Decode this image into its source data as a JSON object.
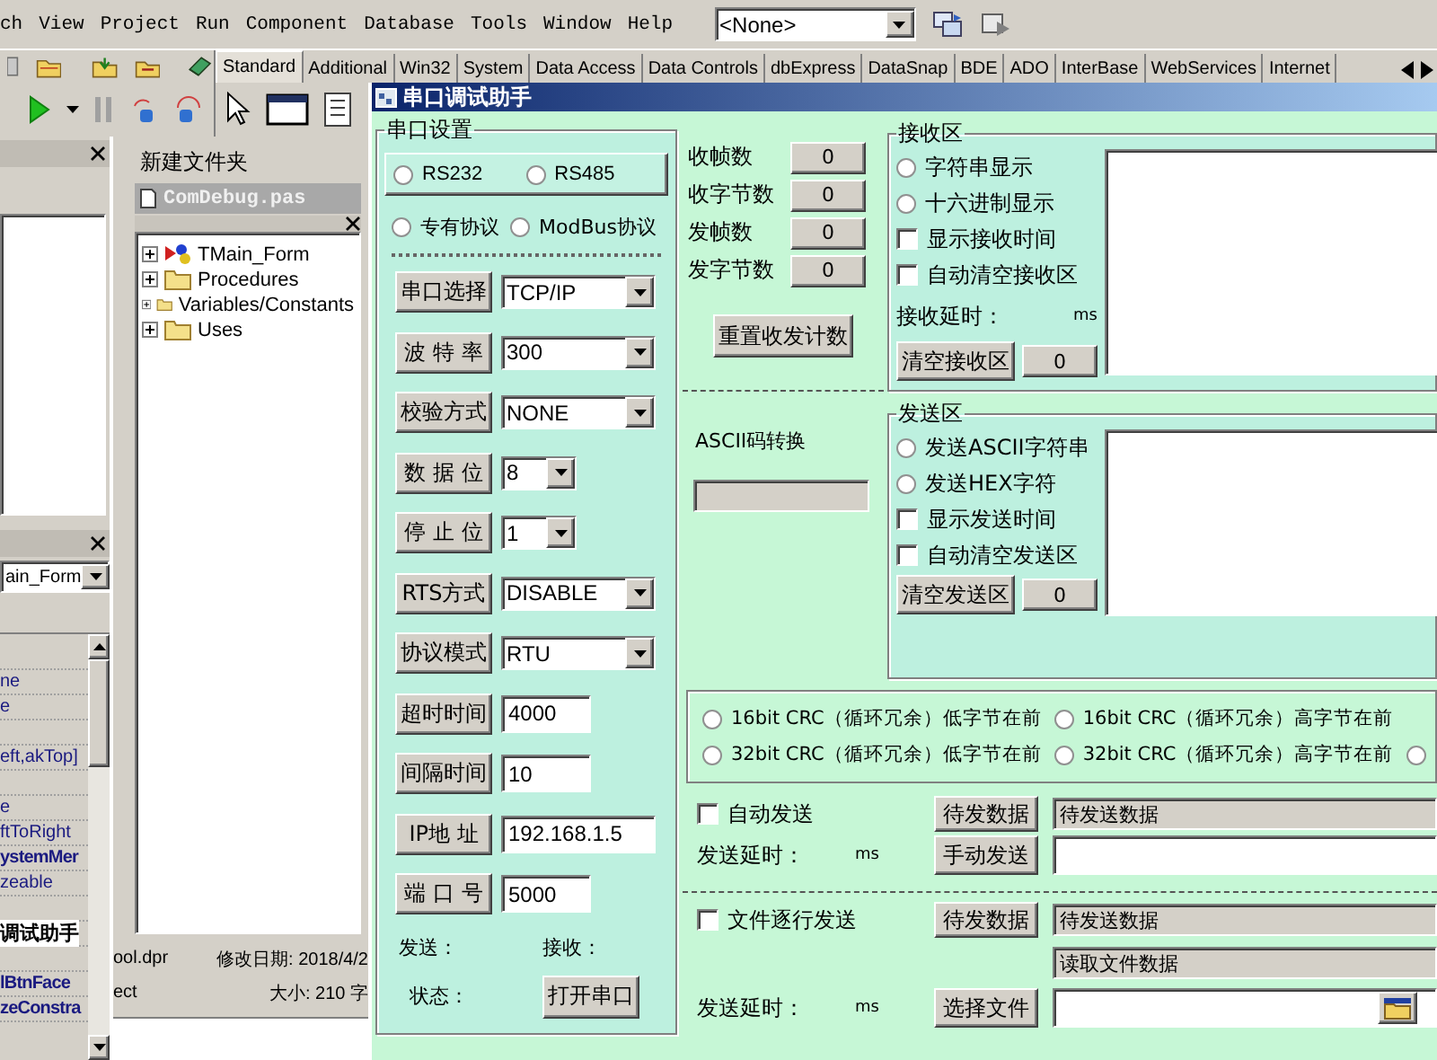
{
  "menu_bar": {
    "items": [
      "ch",
      "View",
      "Project",
      "Run",
      "Component",
      "Database",
      "Tools",
      "Window",
      "Help"
    ],
    "selector": {
      "value": "<None>"
    }
  },
  "component_palette": {
    "tabs": [
      {
        "label": "Standard",
        "selected": true
      },
      {
        "label": "Additional",
        "selected": false
      },
      {
        "label": "Win32",
        "selected": false
      },
      {
        "label": "System",
        "selected": false
      },
      {
        "label": "Data Access",
        "selected": false
      },
      {
        "label": "Data Controls",
        "selected": false
      },
      {
        "label": "dbExpress",
        "selected": false
      },
      {
        "label": "DataSnap",
        "selected": false
      },
      {
        "label": "BDE",
        "selected": false
      },
      {
        "label": "ADO",
        "selected": false
      },
      {
        "label": "InterBase",
        "selected": false
      },
      {
        "label": "WebServices",
        "selected": false
      },
      {
        "label": "Internet",
        "selected": false
      }
    ]
  },
  "inspector": {
    "selector": "ain_Form",
    "rows": [
      {
        "kind": "blank"
      },
      {
        "kind": "plain",
        "value": "ne"
      },
      {
        "kind": "plain",
        "value": "e"
      },
      {
        "kind": "blank"
      },
      {
        "kind": "plain",
        "value": "eft,akTop]"
      },
      {
        "kind": "blank"
      },
      {
        "kind": "plain",
        "value": "e"
      },
      {
        "kind": "plain",
        "value": "ftToRight"
      },
      {
        "kind": "bold",
        "value": "ystemMer"
      },
      {
        "kind": "plain",
        "value": "zeable"
      },
      {
        "kind": "blank"
      },
      {
        "kind": "editing",
        "value": "调试助手"
      },
      {
        "kind": "blank"
      },
      {
        "kind": "bold",
        "value": "lBtnFace"
      },
      {
        "kind": "bold",
        "value": "zeConstra"
      }
    ]
  },
  "explorer": {
    "title": "新建文件夹",
    "file_tab": "ComDebug.pas",
    "tree": [
      {
        "label": "TMain_Form",
        "kind": "component",
        "expanded": false
      },
      {
        "label": "Procedures",
        "kind": "folder",
        "expanded": false
      },
      {
        "label": "Variables/Constants",
        "kind": "folder",
        "expanded": false
      },
      {
        "label": "Uses",
        "kind": "folder",
        "expanded": false
      }
    ],
    "file_info": [
      {
        "left": "ool.dpr",
        "right": "修改日期: 2018/4/2"
      },
      {
        "left": "ect",
        "right": "大小: 210 字"
      }
    ]
  },
  "window": {
    "title": "串口调试助手"
  },
  "port_settings": {
    "title": "串口设置",
    "interface_options": [
      {
        "label": "RS232",
        "selected": false
      },
      {
        "label": "RS485",
        "selected": false
      }
    ],
    "protocol_options": [
      {
        "label": "专有协议",
        "selected": false
      },
      {
        "label": "ModBus协议",
        "selected": false
      }
    ],
    "fields": [
      {
        "label": "串口选择",
        "kind": "select",
        "value": "TCP/IP"
      },
      {
        "label": "波 特 率",
        "kind": "select",
        "value": "300"
      },
      {
        "label": "校验方式",
        "kind": "select",
        "value": "NONE"
      },
      {
        "label": "数 据 位",
        "kind": "minselect",
        "value": "8"
      },
      {
        "label": "停 止 位",
        "kind": "minselect",
        "value": "1"
      },
      {
        "label": "RTS方式",
        "kind": "select",
        "value": "DISABLE"
      },
      {
        "label": "协议模式",
        "kind": "select",
        "value": "RTU"
      },
      {
        "label": "超时时间",
        "kind": "mininput",
        "value": "4000"
      },
      {
        "label": "间隔时间",
        "kind": "mininput",
        "value": "10"
      },
      {
        "label": "IP地 址",
        "kind": "input",
        "value": "192.168.1.5"
      },
      {
        "label": "端 口 号",
        "kind": "mininput",
        "value": "5000"
      }
    ],
    "send_label": "发送：",
    "receive_label": "接收：",
    "state_label": "状态：",
    "open_button": "打开串口"
  },
  "counters": {
    "items": [
      {
        "label": "收帧数",
        "value": "0"
      },
      {
        "label": "收字节数",
        "value": "0"
      },
      {
        "label": "发帧数",
        "value": "0"
      },
      {
        "label": "发字节数",
        "value": "0"
      }
    ],
    "reset_button": "重置收发计数",
    "ascii_label": "ASCII码转换"
  },
  "receive_area": {
    "title": "接收区",
    "options": [
      {
        "kind": "radio",
        "label": "字符串显示",
        "selected": false
      },
      {
        "kind": "radio",
        "label": "十六进制显示",
        "selected": false
      },
      {
        "kind": "checkbox",
        "label": "显示接收时间",
        "checked": false
      },
      {
        "kind": "checkbox",
        "label": "自动清空接收区",
        "checked": false
      }
    ],
    "delay_label": "接收延时：",
    "unit": "ms",
    "clear_button": "清空接收区",
    "count": "0"
  },
  "send_area": {
    "title": "发送区",
    "options": [
      {
        "kind": "radio",
        "label": "发送ASCII字符串",
        "selected": false
      },
      {
        "kind": "radio",
        "label": "发送HEX字符",
        "selected": false
      },
      {
        "kind": "checkbox",
        "label": "显示发送时间",
        "checked": false
      },
      {
        "kind": "checkbox",
        "label": "自动清空发送区",
        "checked": false
      }
    ],
    "clear_button": "清空发送区",
    "count": "0"
  },
  "crc_rows": [
    {
      "options": [
        {
          "label": "16bit CRC（循环冗余）低字节在前",
          "selected": false
        },
        {
          "label": "16bit CRC（循环冗余）高字节在前",
          "selected": false
        }
      ]
    },
    {
      "options": [
        {
          "label": "32bit CRC（循环冗余）低字节在前",
          "selected": false
        },
        {
          "label": "32bit CRC（循环冗余）高字节在前",
          "selected": false
        },
        {
          "selected": false
        }
      ]
    }
  ],
  "auto_send": {
    "label": "自动发送",
    "checked": false,
    "data_button": "待发数据",
    "data_value": "待发送数据",
    "delay_label": "发送延时：",
    "unit": "ms",
    "send_button": "手动发送"
  },
  "file_send": {
    "label": "文件逐行发送",
    "checked": false,
    "data_button": "待发数据",
    "data_value": "待发送数据",
    "file_value": "读取文件数据",
    "delay_label": "发送延时：",
    "unit": "ms",
    "choose_button": "选择文件"
  }
}
